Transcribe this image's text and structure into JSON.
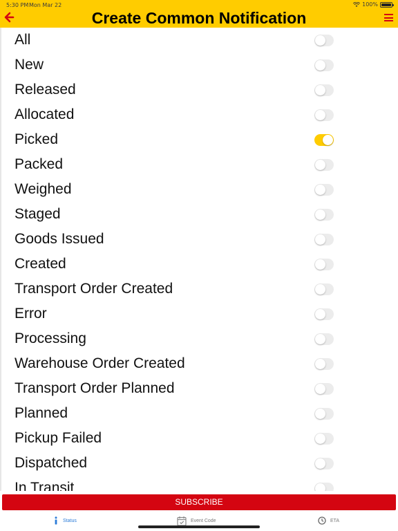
{
  "status_bar": {
    "time": "5:30 PM",
    "date": "Mon Mar 22",
    "battery": "100%"
  },
  "header": {
    "title": "Create Common Notification",
    "background_color": "#ffcc00",
    "back_icon": "arrow-left-icon",
    "menu_icon": "hamburger-menu-icon"
  },
  "statuses": [
    {
      "label": "All",
      "enabled": false
    },
    {
      "label": "New",
      "enabled": false
    },
    {
      "label": "Released",
      "enabled": false
    },
    {
      "label": "Allocated",
      "enabled": false
    },
    {
      "label": "Picked",
      "enabled": true
    },
    {
      "label": "Packed",
      "enabled": false
    },
    {
      "label": "Weighed",
      "enabled": false
    },
    {
      "label": "Staged",
      "enabled": false
    },
    {
      "label": "Goods Issued",
      "enabled": false
    },
    {
      "label": "Created",
      "enabled": false
    },
    {
      "label": "Transport Order Created",
      "enabled": false
    },
    {
      "label": "Error",
      "enabled": false
    },
    {
      "label": "Processing",
      "enabled": false
    },
    {
      "label": "Warehouse Order Created",
      "enabled": false
    },
    {
      "label": "Transport Order Planned",
      "enabled": false
    },
    {
      "label": "Planned",
      "enabled": false
    },
    {
      "label": "Pickup Failed",
      "enabled": false
    },
    {
      "label": "Dispatched",
      "enabled": false
    },
    {
      "label": "In Transit",
      "enabled": false
    }
  ],
  "colors": {
    "accent": "#ffcc00",
    "action": "#d40511",
    "active_tab": "#2a7bd8"
  },
  "subscribe": {
    "label": "SUBSCRIBE"
  },
  "tabs": {
    "status": {
      "label": "Status",
      "icon": "info-icon",
      "active": true
    },
    "event_code": {
      "label": "Event Code",
      "icon": "calendar-icon",
      "active": false
    },
    "eta": {
      "label": "ETA",
      "icon": "clock-icon",
      "active": false
    }
  }
}
